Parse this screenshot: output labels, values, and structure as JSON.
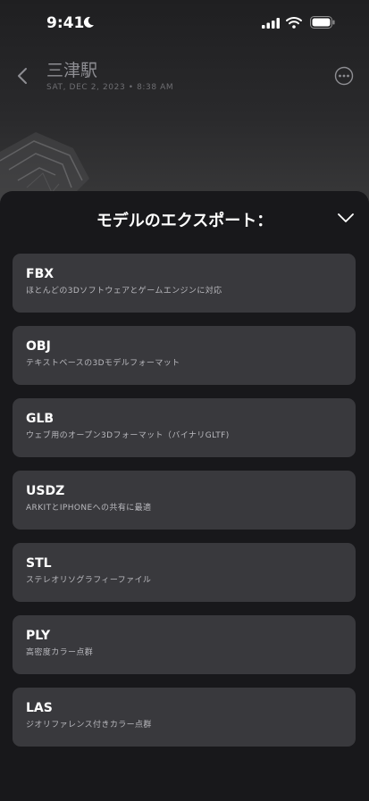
{
  "status_bar": {
    "time": "9:41"
  },
  "nav": {
    "title": "三津駅",
    "subtitle": "SAT, DEC 2, 2023 • 8:38 AM"
  },
  "sheet": {
    "title": "モデルのエクスポート："
  },
  "export_options": [
    {
      "name": "FBX",
      "description": "ほとんどの3Dソフトウェアとゲームエンジンに対応"
    },
    {
      "name": "OBJ",
      "description": "テキストベースの3Dモデルフォーマット"
    },
    {
      "name": "GLB",
      "description": "ウェブ用のオープン3Dフォーマット（バイナリGLTF)"
    },
    {
      "name": "USDZ",
      "description": "ARKITとIPHONEへの共有に最適"
    },
    {
      "name": "STL",
      "description": "ステレオリソグラフィーファイル"
    },
    {
      "name": "PLY",
      "description": "高密度カラー点群"
    },
    {
      "name": "LAS",
      "description": "ジオリファレンス付きカラー点群"
    }
  ]
}
